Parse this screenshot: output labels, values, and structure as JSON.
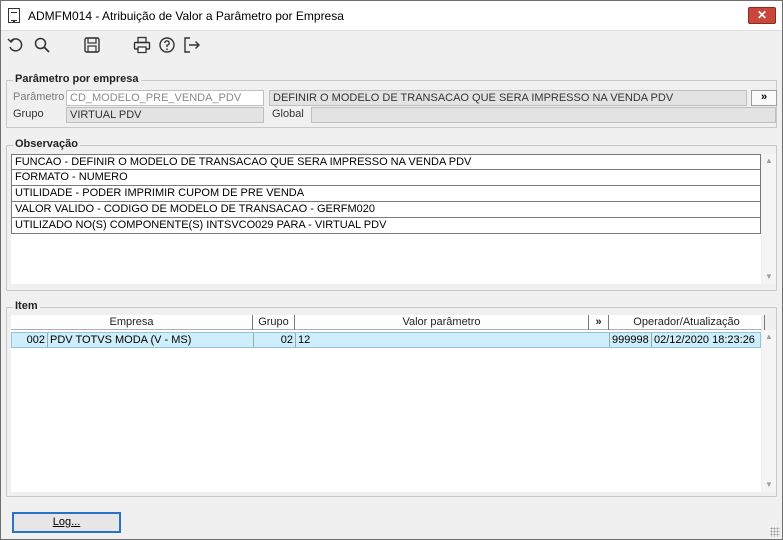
{
  "window": {
    "title": "ADMFM014 - Atribuição de Valor a Parâmetro por Empresa",
    "close_label": "✕"
  },
  "toolbar": {
    "icons": [
      "undo-icon",
      "search-icon",
      "save-icon",
      "print-icon",
      "help-icon",
      "exit-icon"
    ]
  },
  "param_group": {
    "title": "Parâmetro por empresa",
    "param_label": "Parâmetro",
    "param_value": "CD_MODELO_PRE_VENDA_PDV",
    "param_description": "DEFINIR O MODELO DE TRANSACAO QUE SERA IMPRESSO NA VENDA PDV",
    "expand_label": "»",
    "group_label": "Grupo",
    "group_value": "VIRTUAL PDV",
    "global_label": "Global",
    "global_value": ""
  },
  "obs_group": {
    "title": "Observação",
    "lines": [
      "FUNCAO - DEFINIR O MODELO DE TRANSACAO QUE SERA IMPRESSO NA VENDA PDV",
      "FORMATO - NUMERO",
      "UTILIDADE - PODER IMPRIMIR CUPOM DE PRE VENDA",
      "VALOR VALIDO - CODIGO DE MODELO DE TRANSACAO - GERFM020",
      "UTILIZADO NO(S) COMPONENTE(S) INTSVCO029  PARA  - VIRTUAL PDV"
    ]
  },
  "item_group": {
    "title": "Item",
    "columns": {
      "empresa": "Empresa",
      "grupo": "Grupo",
      "valor": "Valor parâmetro",
      "expand": "»",
      "operador": "Operador/Atualização"
    },
    "rows": [
      {
        "empresa_code": "002",
        "empresa_name": "PDV TOTVS MODA  (V - MS)",
        "grupo": "02",
        "valor": "12",
        "operador": "999998",
        "atualizacao": "02/12/2020 18:23:26"
      }
    ]
  },
  "footer": {
    "log_button": "Log..."
  }
}
